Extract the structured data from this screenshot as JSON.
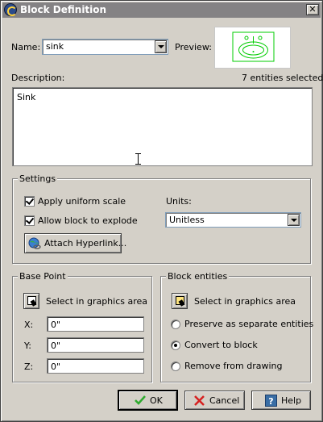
{
  "title": "Block Definition",
  "name_label": "Name:",
  "name_value": "sink",
  "preview_label": "Preview:",
  "description_label": "Description:",
  "entities_selected": "7 entities selected",
  "description_value": "Sink",
  "settings": {
    "title": "Settings",
    "uniform_scale": "Apply uniform scale",
    "uniform_scale_checked": true,
    "allow_explode": "Allow block to explode",
    "allow_explode_checked": true,
    "units_label": "Units:",
    "units_value": "Unitless",
    "hyperlink_button": "Attach Hyperlink..."
  },
  "base_point": {
    "title": "Base Point",
    "select_label": "Select in graphics area",
    "x_label": "X:",
    "x_value": "0\"",
    "y_label": "Y:",
    "y_value": "0\"",
    "z_label": "Z:",
    "z_value": "0\""
  },
  "block_entities": {
    "title": "Block entities",
    "select_label": "Select in graphics area",
    "options": [
      {
        "label": "Preserve as separate entities",
        "checked": false
      },
      {
        "label": "Convert to block",
        "checked": true
      },
      {
        "label": "Remove from drawing",
        "checked": false
      }
    ]
  },
  "buttons": {
    "ok": "OK",
    "cancel": "Cancel",
    "help": "Help"
  },
  "colors": {
    "titlebar": "#848284",
    "preview_line": "#00cc00",
    "ok_check": "#2eaa2e",
    "cancel_x": "#d62020",
    "help_blue": "#3a6ea5"
  }
}
